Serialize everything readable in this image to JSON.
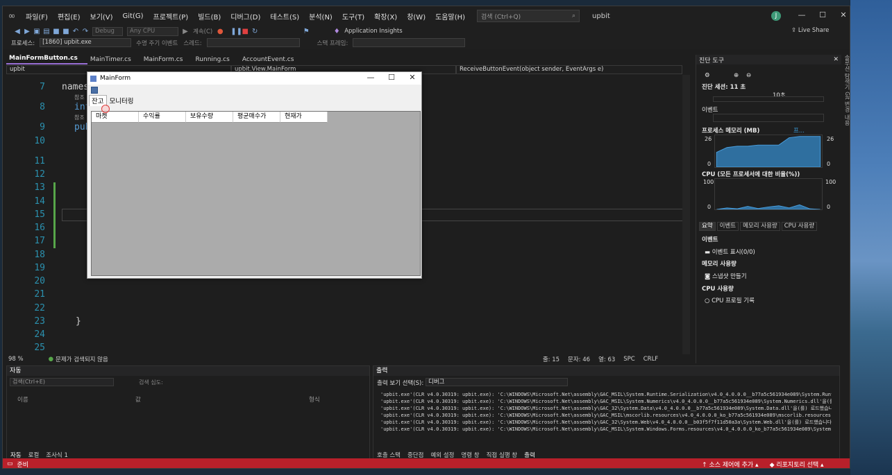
{
  "menubar": {
    "items": [
      "파일(F)",
      "편집(E)",
      "보기(V)",
      "Git(G)",
      "프로젝트(P)",
      "빌드(B)",
      "디버그(D)",
      "테스트(S)",
      "분석(N)",
      "도구(T)",
      "확장(X)",
      "창(W)",
      "도움말(H)"
    ],
    "search_placeholder": "검색 (Ctrl+Q)",
    "app_title": "upbit",
    "avatar_letter": "J"
  },
  "toolbar": {
    "config": "Debug",
    "platform": "Any CPU",
    "continue_label": "계속(C)",
    "app_insights": "Application Insights",
    "live_share": "Live Share",
    "process_label": "프로세스:",
    "process_value": "[1860] upbit.exe",
    "lifecycle_label": "수명 주기 이벤트",
    "thread_label": "스레드:",
    "stack_label": "스택 프레임:"
  },
  "tabs": [
    "MainFormButton.cs",
    "MainTimer.cs",
    "MainForm.cs",
    "Running.cs",
    "AccountEvent.cs"
  ],
  "navbar": {
    "project": "upbit",
    "class": "upbit.View.MainForm",
    "member": "ReceiveButtonEvent(object sender, EventArgs e)"
  },
  "editor": {
    "line_numbers": [
      "7",
      "8",
      "9",
      "10",
      "11",
      "12",
      "13",
      "14",
      "15",
      "16",
      "17",
      "18",
      "19",
      "20",
      "21",
      "22",
      "23",
      "24",
      "25"
    ],
    "code_namespace": "names",
    "code_internal": "inte",
    "code_public": "pub",
    "code_brace": "}",
    "refs_label": "참조",
    "zoom": "98 %",
    "no_issues": "문제가 검색되지 않음",
    "line": "줄: 15",
    "char": "문자: 46",
    "col": "열: 63",
    "spc": "SPC",
    "crlf": "CRLF"
  },
  "form": {
    "title": "MainForm",
    "tabs": [
      "잔고",
      "모니터링"
    ],
    "columns": [
      "마켓",
      "수익률",
      "보유수량",
      "평균매수가",
      "현재가"
    ]
  },
  "diagnostics": {
    "title": "진단 도구",
    "session": "진단 세션: 11 초",
    "timeline_label": "10초",
    "events_label": "이벤트",
    "memory_label": "프로세스 메모리 (MB)",
    "memory_legend": "프...",
    "memory_max": "26",
    "memory_min": "0",
    "cpu_label": "CPU (모든 프로세서에 대한 비율(%))",
    "cpu_max": "100",
    "cpu_min": "0",
    "tabs": [
      "요약",
      "이벤트",
      "메모리 사용량",
      "CPU 사용량"
    ],
    "summary_events": "이벤트",
    "show_events": "이벤트 표시(0/0)",
    "memory_usage": "메모리 사용량",
    "snapshot": "스냅샷 만들기",
    "cpu_usage": "CPU 사용량",
    "cpu_profile": "CPU 프로필 기록"
  },
  "side_tabs": "솔루션 탐색기   Git 변경 내용",
  "auto_panel": {
    "title": "자동",
    "search_placeholder": "검색(Ctrl+E)",
    "search_depth": "검색 심도:",
    "col_name": "이름",
    "col_value": "값",
    "col_type": "형식",
    "tabs": [
      "자동",
      "로컬",
      "조사식 1"
    ]
  },
  "output_panel": {
    "title": "출력",
    "source_label": "출력 보기 선택(S):",
    "source_value": "디버그",
    "lines": [
      "'upbit.exe'(CLR v4.0.30319: upbit.exe): 'C:\\WINDOWS\\Microsoft.Net\\assembly\\GAC_MSIL\\System.Runtime.Serialization\\v4.0_4.0.0.0__b77a5c561934e089\\System.Runtime.Se",
      "'upbit.exe'(CLR v4.0.30319: upbit.exe): 'C:\\WINDOWS\\Microsoft.Net\\assembly\\GAC_MSIL\\System.Numerics\\v4.0_4.0.0.0__b77a5c561934e089\\System.Numerics.dll'을(를) 로",
      "'upbit.exe'(CLR v4.0.30319: upbit.exe): 'C:\\WINDOWS\\Microsoft.Net\\assembly\\GAC_32\\System.Data\\v4.0_4.0.0.0__b77a5c561934e089\\System.Data.dll'을(를) 로드했습니다",
      "'upbit.exe'(CLR v4.0.30319: upbit.exe): 'C:\\WINDOWS\\Microsoft.Net\\assembly\\GAC_MSIL\\mscorlib.resources\\v4.0_4.0.0.0_ko_b77a5c561934e089\\mscorlib.resources.dll'을",
      "'upbit.exe'(CLR v4.0.30319: upbit.exe): 'C:\\WINDOWS\\Microsoft.Net\\assembly\\GAC_32\\System.Web\\v4.0_4.0.0.0__b03f5f7f11d50a3a\\System.Web.dll'을(를) 로드했습니다.",
      "'upbit.exe'(CLR v4.0.30319: upbit.exe): 'C:\\WINDOWS\\Microsoft.Net\\assembly\\GAC_MSIL\\System.Windows.Forms.resources\\v4.0_4.0.0.0_ko_b77a5c561934e089\\System.Window"
    ],
    "tabs": [
      "호출 스택",
      "중단점",
      "예외 설정",
      "명령 창",
      "직접 실행 창",
      "출력"
    ]
  },
  "statusbar": {
    "ready": "준비",
    "source_control": "소스 제어에 추가",
    "repo": "리포지토리 선택"
  },
  "colors": {
    "statusbar": "#b8202a",
    "accent": "#9a6fd6"
  },
  "chart_data": [
    {
      "type": "area",
      "title": "프로세스 메모리 (MB)",
      "ylim": [
        0,
        26
      ],
      "x": [
        0,
        1,
        2,
        3,
        4,
        5,
        6,
        7,
        8,
        9,
        10
      ],
      "values": [
        12,
        16,
        17,
        17,
        18,
        18,
        18,
        24,
        25,
        25,
        25
      ]
    },
    {
      "type": "area",
      "title": "CPU (모든 프로세서에 대한 비율(%))",
      "ylim": [
        0,
        100
      ],
      "x": [
        0,
        1,
        2,
        3,
        4,
        5,
        6,
        7,
        8,
        9,
        10
      ],
      "values": [
        0,
        5,
        2,
        10,
        3,
        8,
        12,
        5,
        15,
        2,
        0
      ]
    }
  ]
}
